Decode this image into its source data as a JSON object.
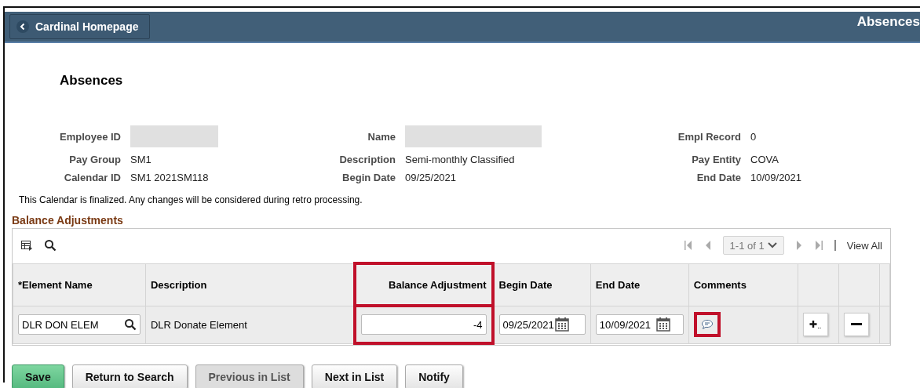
{
  "header": {
    "back_button": "Cardinal Homepage",
    "title": "Absences"
  },
  "page_title": "Absences",
  "fields": [
    {
      "label": "Employee ID",
      "kind": "redacted"
    },
    {
      "label": "Name",
      "kind": "redacted"
    },
    {
      "label": "Empl Record",
      "kind": "text",
      "value": "0"
    },
    {
      "label": "Pay Group",
      "kind": "text",
      "value": "SM1"
    },
    {
      "label": "Description",
      "kind": "text",
      "value": "Semi-monthly Classified"
    },
    {
      "label": "Pay Entity",
      "kind": "text",
      "value": "COVA"
    },
    {
      "label": "Calendar ID",
      "kind": "text",
      "value": "SM1 2021SM118"
    },
    {
      "label": "Begin Date",
      "kind": "text",
      "value": "09/25/2021"
    },
    {
      "label": "End Date",
      "kind": "text",
      "value": "10/09/2021"
    }
  ],
  "note": "This Calendar is finalized. Any changes will be considered during retro processing.",
  "grid": {
    "title": "Balance Adjustments",
    "pager": "1-1 of 1",
    "view_all": "View All",
    "columns": [
      {
        "label": "*Element Name",
        "highlighted": false
      },
      {
        "label": "Description",
        "highlighted": false
      },
      {
        "label": "Balance Adjustment",
        "highlighted": true
      },
      {
        "label": "Begin Date",
        "highlighted": false
      },
      {
        "label": "End Date",
        "highlighted": false
      },
      {
        "label": "Comments",
        "highlighted": false
      }
    ],
    "rows": [
      {
        "element_name": "DLR DON ELEM",
        "description": "DLR Donate Element",
        "balance_adjustment": "-4",
        "begin_date": "09/25/2021",
        "end_date": "10/09/2021",
        "comment_highlighted": true
      }
    ]
  },
  "buttons": [
    {
      "label": "Save",
      "kind": "primary",
      "disabled": false
    },
    {
      "label": "Return to Search",
      "kind": "normal",
      "disabled": false
    },
    {
      "label": "Previous in List",
      "kind": "normal",
      "disabled": true
    },
    {
      "label": "Next in List",
      "kind": "normal",
      "disabled": false
    },
    {
      "label": "Notify",
      "kind": "normal",
      "disabled": false
    }
  ]
}
